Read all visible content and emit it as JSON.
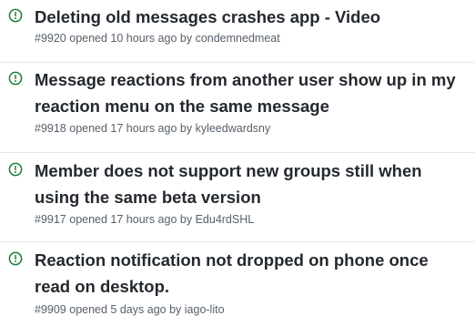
{
  "colors": {
    "open_icon": "#1a7f37",
    "title": "#24292f",
    "meta": "#57606a",
    "divider": "#e5e7ea"
  },
  "issues": [
    {
      "title": "Deleting old messages crashes app - Video",
      "number": "#9920",
      "opened": "opened 10 hours ago by",
      "author": "condemnedmeat",
      "icon": "issue-opened-icon"
    },
    {
      "title": "Message reactions from another user show up in my reaction menu on the same message",
      "number": "#9918",
      "opened": "opened 17 hours ago by",
      "author": "kyleedwardsny",
      "icon": "issue-opened-icon"
    },
    {
      "title": "Member does not support new groups still when using the same beta version",
      "number": "#9917",
      "opened": "opened 17 hours ago by",
      "author": "Edu4rdSHL",
      "icon": "issue-opened-icon"
    },
    {
      "title": "Reaction notification not dropped on phone once read on desktop.",
      "number": "#9909",
      "opened": "opened 5 days ago by",
      "author": "iago-lito",
      "icon": "issue-opened-icon"
    }
  ]
}
